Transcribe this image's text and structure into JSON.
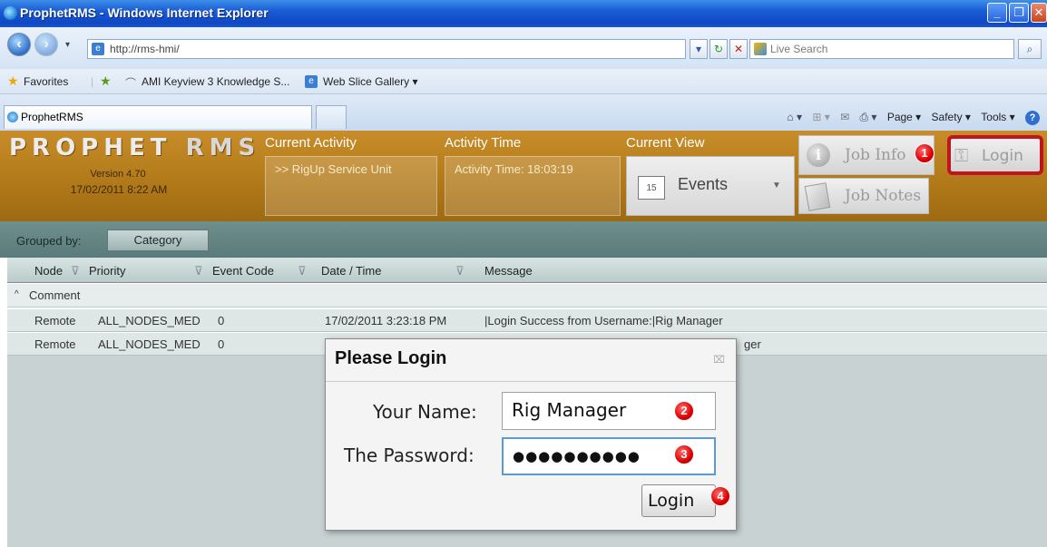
{
  "window": {
    "title": "ProphetRMS - Windows Internet Explorer",
    "min": "_",
    "max": "❐",
    "close": "✕"
  },
  "address": {
    "url": "http://rms-hmi/",
    "search_placeholder": "Live Search"
  },
  "favorites": {
    "label": "Favorites",
    "items": [
      "AMI Keyview 3 Knowledge S...",
      "Web Slice Gallery ▾"
    ]
  },
  "tabs": {
    "active": "ProphetRMS"
  },
  "commands": {
    "page": "Page ▾",
    "safety": "Safety ▾",
    "tools": "Tools ▾",
    "help": "?"
  },
  "app": {
    "logo_main": "PROPHET",
    "logo_rms": "RMS",
    "version": "Version 4.70",
    "datetime": "17/02/2011 8:22 AM",
    "current_activity_label": "Current Activity",
    "current_activity_value": ">> RigUp Service Unit",
    "activity_time_label": "Activity Time",
    "activity_time_value": "Activity Time: 18:03:19",
    "current_view_label": "Current View",
    "current_view_value": "Events",
    "calendar_day": "15",
    "job_info": "Job Info",
    "job_notes": "Job Notes",
    "login": "Login"
  },
  "grouping": {
    "label": "Grouped by:",
    "value": "Category"
  },
  "table": {
    "headers": [
      "Node",
      "Priority",
      "Event Code",
      "Date / Time",
      "Message"
    ],
    "group": "Comment",
    "rows": [
      {
        "node": "Remote",
        "priority": "ALL_NODES_MED",
        "code": "0",
        "datetime": "17/02/2011 3:23:18 PM",
        "message": "|Login Success from Username:|Rig Manager"
      },
      {
        "node": "Remote",
        "priority": "ALL_NODES_MED",
        "code": "0",
        "datetime": "",
        "message": "ger"
      }
    ]
  },
  "dialog": {
    "title": "Please Login",
    "close": "⌧",
    "name_label": "Your Name:",
    "name_value": "Rig Manager",
    "password_label": "The Password:",
    "password_value": "●●●●●●●●●●",
    "login_button": "Login"
  },
  "badges": [
    "1",
    "2",
    "3",
    "4"
  ]
}
